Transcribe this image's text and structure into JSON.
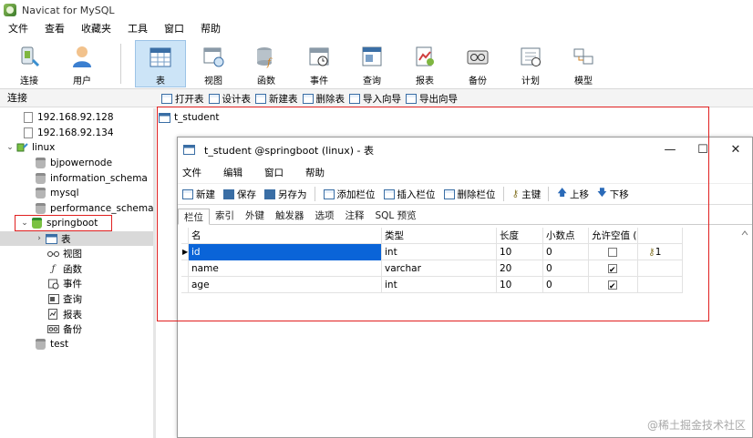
{
  "window": {
    "title": "Navicat for MySQL"
  },
  "menu": [
    "文件",
    "查看",
    "收藏夹",
    "工具",
    "窗口",
    "帮助"
  ],
  "toolbar": [
    {
      "id": "connect",
      "label": "连接",
      "icon": "connect-icon"
    },
    {
      "id": "user",
      "label": "用户",
      "icon": "user-icon"
    },
    {
      "id": "table",
      "label": "表",
      "icon": "table-icon",
      "active": true
    },
    {
      "id": "view",
      "label": "视图",
      "icon": "view-icon"
    },
    {
      "id": "function",
      "label": "函数",
      "icon": "function-icon"
    },
    {
      "id": "event",
      "label": "事件",
      "icon": "event-icon"
    },
    {
      "id": "query",
      "label": "查询",
      "icon": "query-icon"
    },
    {
      "id": "report",
      "label": "报表",
      "icon": "report-icon"
    },
    {
      "id": "backup",
      "label": "备份",
      "icon": "backup-icon"
    },
    {
      "id": "schedule",
      "label": "计划",
      "icon": "schedule-icon"
    },
    {
      "id": "model",
      "label": "模型",
      "icon": "model-icon"
    }
  ],
  "subbar": {
    "connection_label": "连接",
    "buttons": [
      "打开表",
      "设计表",
      "新建表",
      "删除表",
      "导入向导",
      "导出向导"
    ]
  },
  "tree": [
    {
      "label": "192.168.92.128",
      "kind": "connection",
      "level": 0
    },
    {
      "label": "192.168.92.134",
      "kind": "connection",
      "level": 0
    },
    {
      "label": "linux",
      "kind": "server",
      "level": 0,
      "expanded": true
    },
    {
      "label": "bjpowernode",
      "kind": "database",
      "level": 1
    },
    {
      "label": "information_schema",
      "kind": "database",
      "level": 1
    },
    {
      "label": "mysql",
      "kind": "database",
      "level": 1
    },
    {
      "label": "performance_schema",
      "kind": "database",
      "level": 1
    },
    {
      "label": "springboot",
      "kind": "database-open",
      "level": 1,
      "expanded": true
    },
    {
      "label": "表",
      "kind": "tables",
      "level": 2,
      "selected": true
    },
    {
      "label": "视图",
      "kind": "views",
      "level": 2
    },
    {
      "label": "函数",
      "kind": "functions",
      "level": 2
    },
    {
      "label": "事件",
      "kind": "events",
      "level": 2
    },
    {
      "label": "查询",
      "kind": "queries",
      "level": 2
    },
    {
      "label": "报表",
      "kind": "reports",
      "level": 2
    },
    {
      "label": "备份",
      "kind": "backups",
      "level": 2
    },
    {
      "label": "test",
      "kind": "database",
      "level": 1
    }
  ],
  "main": {
    "object_tab": "t_student"
  },
  "designer": {
    "title": "t_student @springboot (linux) - 表",
    "menu": [
      "文件",
      "编辑",
      "窗口",
      "帮助"
    ],
    "tools": [
      "新建",
      "保存",
      "另存为",
      "添加栏位",
      "插入栏位",
      "删除栏位",
      "主键",
      "上移",
      "下移"
    ],
    "tabs": [
      "栏位",
      "索引",
      "外键",
      "触发器",
      "选项",
      "注释",
      "SQL 预览"
    ],
    "columns": [
      "名",
      "类型",
      "长度",
      "小数点",
      "允许空值 (",
      ""
    ],
    "rows": [
      {
        "name": "id",
        "type": "int",
        "length": "10",
        "decimals": "0",
        "nullable": false,
        "key": "1"
      },
      {
        "name": "name",
        "type": "varchar",
        "length": "20",
        "decimals": "0",
        "nullable": true,
        "key": ""
      },
      {
        "name": "age",
        "type": "int",
        "length": "10",
        "decimals": "0",
        "nullable": true,
        "key": ""
      }
    ]
  },
  "watermark": "@稀土掘金技术社区",
  "colors": {
    "annotation_red": "#e02020",
    "selection_blue": "#0a64d8",
    "active_tool": "#cce4f7"
  }
}
